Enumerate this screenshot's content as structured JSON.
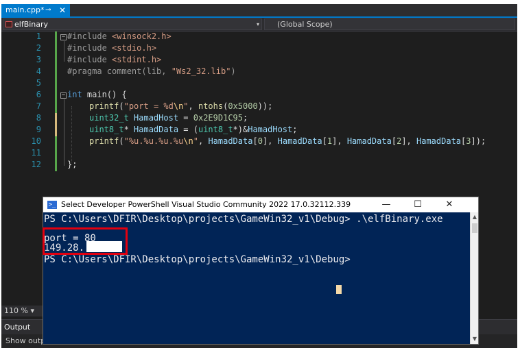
{
  "editor": {
    "tab": {
      "title": "main.cpp*",
      "pin_glyph": "⊸",
      "close_glyph": "✕"
    },
    "nav": {
      "project": "elfBinary",
      "dropdown_glyph": "▾",
      "scope": "(Global Scope)"
    },
    "line_numbers": [
      "1",
      "2",
      "3",
      "4",
      "5",
      "6",
      "7",
      "8",
      "9",
      "10",
      "11",
      "12"
    ],
    "fold_glyphs": {
      "include": "−",
      "main": "−"
    },
    "zoom": "110 %",
    "zoom_arrow": "▾",
    "output_label": "Output",
    "output_sub": "Show output from: Build"
  },
  "code": {
    "l1": [
      "#include ",
      "<winsock2.h>"
    ],
    "l2": [
      "#include ",
      "<stdio.h>"
    ],
    "l3": [
      "#include ",
      "<stdint.h>"
    ],
    "l4": [
      "#pragma comment(lib, ",
      "\"Ws2_32.lib\"",
      ")"
    ],
    "l6": [
      "int",
      " main() {"
    ],
    "l7": [
      "printf",
      "(",
      "\"port = %d",
      "\\n",
      "\"",
      ", ",
      "ntohs",
      "(",
      "0x5000",
      "));"
    ],
    "l8": [
      "uint32_t",
      " ",
      "HamadHost",
      " = ",
      "0x2E9D1C95",
      ";"
    ],
    "l9": [
      "uint8_t",
      "* ",
      "HamadData",
      " = (",
      "uint8_t",
      "*)&",
      "HamadHost",
      ";"
    ],
    "l10": [
      "printf",
      "(",
      "\"%u.%u.%u.%u",
      "\\n",
      "\"",
      ", ",
      "HamadData",
      "[",
      "0",
      "], ",
      "HamadData",
      "[",
      "1",
      "], ",
      "HamadData",
      "[",
      "2",
      "], ",
      "HamadData",
      "[",
      "3",
      "]);"
    ],
    "l12": [
      "};"
    ]
  },
  "powershell": {
    "title": "Select Developer PowerShell Visual Studio Community 2022 17.0.32112.339",
    "icon_glyph": ">_",
    "minimize_glyph": "—",
    "maximize_glyph": "☐",
    "close_glyph": "✕",
    "lines": [
      "PS C:\\Users\\DFIR\\Desktop\\projects\\GameWin32_v1\\Debug> .\\elfBinary.exe",
      "",
      "port = 80",
      "149.28.",
      "PS C:\\Users\\DFIR\\Desktop\\projects\\GameWin32_v1\\Debug>"
    ],
    "scroll_up": "▲",
    "scroll_down": "▼"
  },
  "colors": {
    "editor_bg": "#1e1e1e",
    "accent": "#007acc",
    "powershell_bg": "#012456",
    "highlight": "#e3000f"
  }
}
